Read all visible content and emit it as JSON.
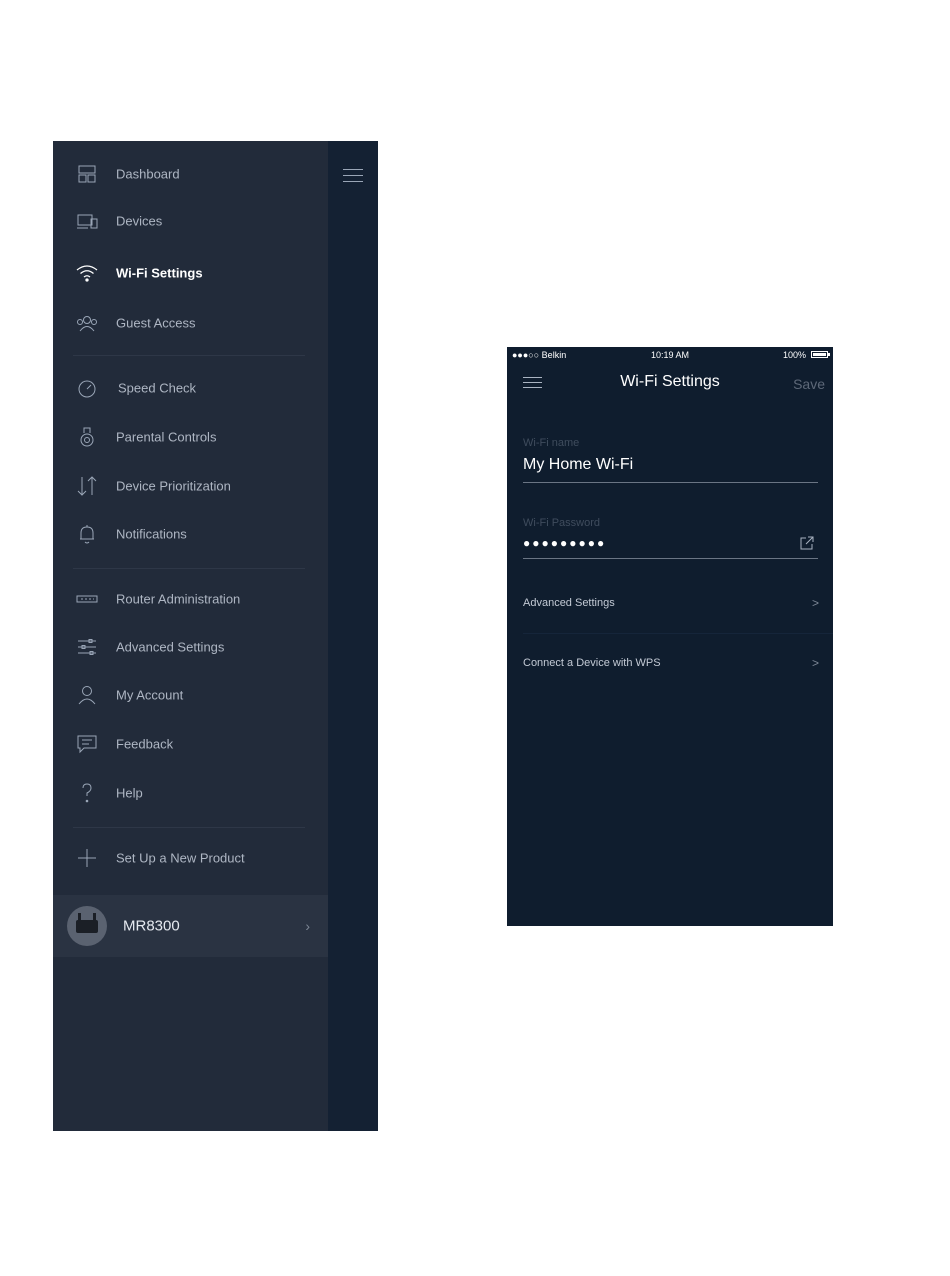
{
  "drawer": {
    "nav_items": [
      {
        "label": "Dashboard",
        "icon": "dashboard-icon"
      },
      {
        "label": "Devices",
        "icon": "devices-icon"
      },
      {
        "label": "Wi-Fi Settings",
        "icon": "wifi-icon",
        "active": true
      },
      {
        "label": "Guest Access",
        "icon": "guest-access-icon"
      },
      {
        "label": "Speed Check",
        "icon": "speedometer-icon"
      },
      {
        "label": "Parental Controls",
        "icon": "parental-controls-icon"
      },
      {
        "label": "Device Prioritization",
        "icon": "prioritization-arrows-icon"
      },
      {
        "label": "Notifications",
        "icon": "bell-icon"
      },
      {
        "label": "Router Administration",
        "icon": "router-icon"
      },
      {
        "label": "Advanced Settings",
        "icon": "sliders-icon"
      },
      {
        "label": "My Account",
        "icon": "user-icon"
      },
      {
        "label": "Feedback",
        "icon": "chat-bubble-icon"
      },
      {
        "label": "Help",
        "icon": "question-mark-icon"
      },
      {
        "label": "Set Up a New Product",
        "icon": "plus-icon"
      }
    ],
    "product": {
      "name": "MR8300",
      "chevron": "›"
    }
  },
  "phone": {
    "status": {
      "carrier": "●●●○○ Belkin",
      "time": "10:19 AM",
      "battery": "100%"
    },
    "title": "Wi-Fi Settings",
    "save_label": "Save",
    "wifi_name": {
      "label": "Wi-Fi name",
      "value": "My Home Wi-Fi"
    },
    "wifi_password": {
      "label": "Wi-Fi Password",
      "masked": "●●●●●●●●●"
    },
    "rows": [
      {
        "label": "Advanced Settings",
        "chevron": ">"
      },
      {
        "label": "Connect a Device with WPS",
        "chevron": ">"
      }
    ]
  },
  "colors": {
    "drawer_bg": "#222b3a",
    "drawer_edge": "#142133",
    "phone_bg": "#0f1d2e",
    "text_muted": "#aeb6c3"
  }
}
